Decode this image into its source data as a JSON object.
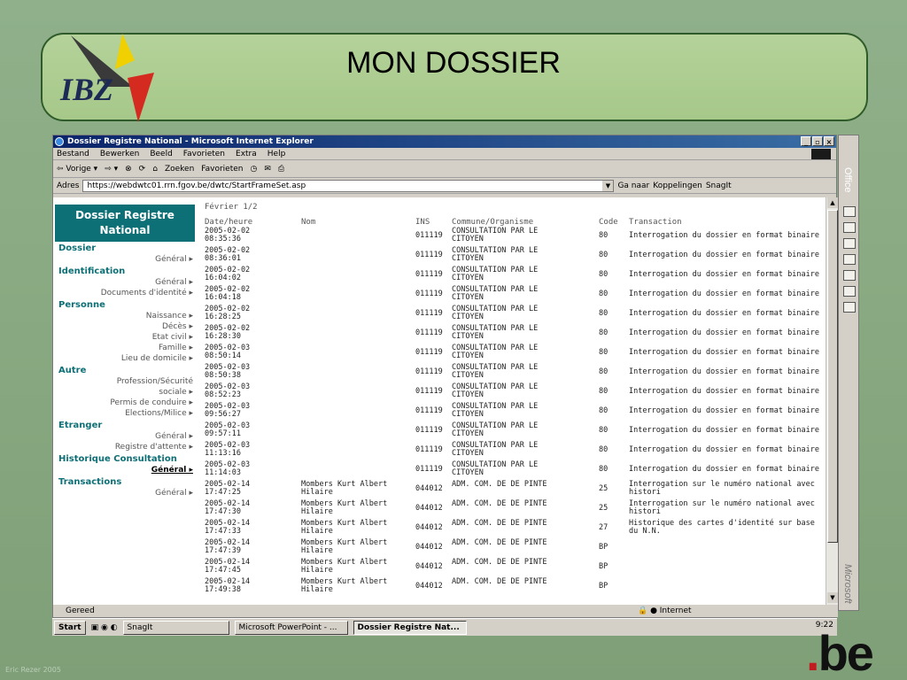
{
  "slide": {
    "title": "MON DOSSIER",
    "logo_text": "IBZ",
    "be_logo_dot": ".",
    "be_logo_text": "be",
    "footer": "Eric Rezer 2005"
  },
  "browser": {
    "window_title": "Dossier Registre National - Microsoft Internet Explorer",
    "menu": [
      "Bestand",
      "Bewerken",
      "Beeld",
      "Favorieten",
      "Extra",
      "Help"
    ],
    "toolbar": [
      "⇦ Vorige ▾",
      "⇨ ▾",
      "Zoeken",
      "Favorieten"
    ],
    "address_label": "Adres",
    "address_url": "https://webdwtc01.rrn.fgov.be/dwtc/StartFrameSet.asp",
    "go_label": "Ga naar",
    "links_label": "Koppelingen",
    "snagit_label": "SnagIt",
    "status_text": "Gereed",
    "zone_text": "Internet"
  },
  "sidebar": {
    "title": "Dossier Registre National",
    "sections": [
      {
        "label": "Dossier",
        "items": [
          "Général ▸"
        ]
      },
      {
        "label": "Identification",
        "items": [
          "Général ▸",
          "Documents d'identité ▸"
        ]
      },
      {
        "label": "Personne",
        "items": [
          "Naissance ▸",
          "Décès ▸",
          "Etat civil ▸",
          "Famille ▸",
          "Lieu de domicile ▸"
        ]
      },
      {
        "label": "Autre",
        "items": [
          "Profession/Sécurité",
          "sociale ▸",
          "Permis de conduire ▸",
          "Elections/Milice ▸"
        ]
      },
      {
        "label": "Etranger",
        "items": [
          "Général ▸",
          "Registre d'attente ▸"
        ]
      },
      {
        "label": "Historique Consultation",
        "items": [
          "Général ▸"
        ]
      },
      {
        "label": "Transactions",
        "items": [
          "Général ▸"
        ]
      }
    ]
  },
  "table": {
    "page": "Février 1/2",
    "headers": [
      "Date/heure",
      "Nom",
      "INS",
      "Commune/Organisme",
      "Code",
      "Transaction"
    ],
    "rows": [
      {
        "date": "2005-02-02",
        "time": "08:35:36",
        "nom1": "",
        "nom2": "",
        "ins": "011119",
        "org1": "CONSULTATION PAR LE",
        "org2": "CITOYEN",
        "code": "80",
        "trans1": "Interrogation du dossier en format binaire",
        "trans2": ""
      },
      {
        "date": "2005-02-02",
        "time": "08:36:01",
        "nom1": "",
        "nom2": "",
        "ins": "011119",
        "org1": "CONSULTATION PAR LE",
        "org2": "CITOYEN",
        "code": "80",
        "trans1": "Interrogation du dossier en format binaire",
        "trans2": ""
      },
      {
        "date": "2005-02-02",
        "time": "16:04:02",
        "nom1": "",
        "nom2": "",
        "ins": "011119",
        "org1": "CONSULTATION PAR LE",
        "org2": "CITOYEN",
        "code": "80",
        "trans1": "Interrogation du dossier en format binaire",
        "trans2": ""
      },
      {
        "date": "2005-02-02",
        "time": "16:04:18",
        "nom1": "",
        "nom2": "",
        "ins": "011119",
        "org1": "CONSULTATION PAR LE",
        "org2": "CITOYEN",
        "code": "80",
        "trans1": "Interrogation du dossier en format binaire",
        "trans2": ""
      },
      {
        "date": "2005-02-02",
        "time": "16:28:25",
        "nom1": "",
        "nom2": "",
        "ins": "011119",
        "org1": "CONSULTATION PAR LE",
        "org2": "CITOYEN",
        "code": "80",
        "trans1": "Interrogation du dossier en format binaire",
        "trans2": ""
      },
      {
        "date": "2005-02-02",
        "time": "16:28:30",
        "nom1": "",
        "nom2": "",
        "ins": "011119",
        "org1": "CONSULTATION PAR LE",
        "org2": "CITOYEN",
        "code": "80",
        "trans1": "Interrogation du dossier en format binaire",
        "trans2": ""
      },
      {
        "date": "2005-02-03",
        "time": "08:50:14",
        "nom1": "",
        "nom2": "",
        "ins": "011119",
        "org1": "CONSULTATION PAR LE",
        "org2": "CITOYEN",
        "code": "80",
        "trans1": "Interrogation du dossier en format binaire",
        "trans2": ""
      },
      {
        "date": "2005-02-03",
        "time": "08:50:38",
        "nom1": "",
        "nom2": "",
        "ins": "011119",
        "org1": "CONSULTATION PAR LE",
        "org2": "CITOYEN",
        "code": "80",
        "trans1": "Interrogation du dossier en format binaire",
        "trans2": ""
      },
      {
        "date": "2005-02-03",
        "time": "08:52:23",
        "nom1": "",
        "nom2": "",
        "ins": "011119",
        "org1": "CONSULTATION PAR LE",
        "org2": "CITOYEN",
        "code": "80",
        "trans1": "Interrogation du dossier en format binaire",
        "trans2": ""
      },
      {
        "date": "2005-02-03",
        "time": "09:56:27",
        "nom1": "",
        "nom2": "",
        "ins": "011119",
        "org1": "CONSULTATION PAR LE",
        "org2": "CITOYEN",
        "code": "80",
        "trans1": "Interrogation du dossier en format binaire",
        "trans2": ""
      },
      {
        "date": "2005-02-03",
        "time": "09:57:11",
        "nom1": "",
        "nom2": "",
        "ins": "011119",
        "org1": "CONSULTATION PAR LE",
        "org2": "CITOYEN",
        "code": "80",
        "trans1": "Interrogation du dossier en format binaire",
        "trans2": ""
      },
      {
        "date": "2005-02-03",
        "time": "11:13:16",
        "nom1": "",
        "nom2": "",
        "ins": "011119",
        "org1": "CONSULTATION PAR LE",
        "org2": "CITOYEN",
        "code": "80",
        "trans1": "Interrogation du dossier en format binaire",
        "trans2": ""
      },
      {
        "date": "2005-02-03",
        "time": "11:14:03",
        "nom1": "",
        "nom2": "",
        "ins": "011119",
        "org1": "CONSULTATION PAR LE",
        "org2": "CITOYEN",
        "code": "80",
        "trans1": "Interrogation du dossier en format binaire",
        "trans2": ""
      },
      {
        "date": "2005-02-14",
        "time": "17:47:25",
        "nom1": "Mombers Kurt Albert",
        "nom2": "Hilaire",
        "ins": "044012",
        "org1": "ADM. COM. DE DE PINTE",
        "org2": "",
        "code": "25",
        "trans1": "Interrogation sur le numéro national avec",
        "trans2": "histori"
      },
      {
        "date": "2005-02-14",
        "time": "17:47:30",
        "nom1": "Mombers Kurt Albert",
        "nom2": "Hilaire",
        "ins": "044012",
        "org1": "ADM. COM. DE DE PINTE",
        "org2": "",
        "code": "25",
        "trans1": "Interrogation sur le numéro national avec",
        "trans2": "histori"
      },
      {
        "date": "2005-02-14",
        "time": "17:47:33",
        "nom1": "Mombers Kurt Albert",
        "nom2": "Hilaire",
        "ins": "044012",
        "org1": "ADM. COM. DE DE PINTE",
        "org2": "",
        "code": "27",
        "trans1": "Historique des cartes d'identité sur base",
        "trans2": "du N.N."
      },
      {
        "date": "2005-02-14",
        "time": "17:47:39",
        "nom1": "Mombers Kurt Albert",
        "nom2": "Hilaire",
        "ins": "044012",
        "org1": "ADM. COM. DE DE PINTE",
        "org2": "",
        "code": "BP",
        "trans1": "",
        "trans2": ""
      },
      {
        "date": "2005-02-14",
        "time": "17:47:45",
        "nom1": "Mombers Kurt Albert",
        "nom2": "Hilaire",
        "ins": "044012",
        "org1": "ADM. COM. DE DE PINTE",
        "org2": "",
        "code": "BP",
        "trans1": "",
        "trans2": ""
      },
      {
        "date": "2005-02-14",
        "time": "17:49:38",
        "nom1": "Mombers Kurt Albert",
        "nom2": "Hilaire",
        "ins": "044012",
        "org1": "ADM. COM. DE DE PINTE",
        "org2": "",
        "code": "BP",
        "trans1": "",
        "trans2": ""
      }
    ]
  },
  "taskbar": {
    "start": "Start",
    "items": [
      "SnagIt",
      "Microsoft PowerPoint - ...",
      "Dossier Registre Nat..."
    ],
    "clock": "9:22"
  },
  "office_bar": {
    "label": "Office",
    "brand": "Microsoft"
  }
}
